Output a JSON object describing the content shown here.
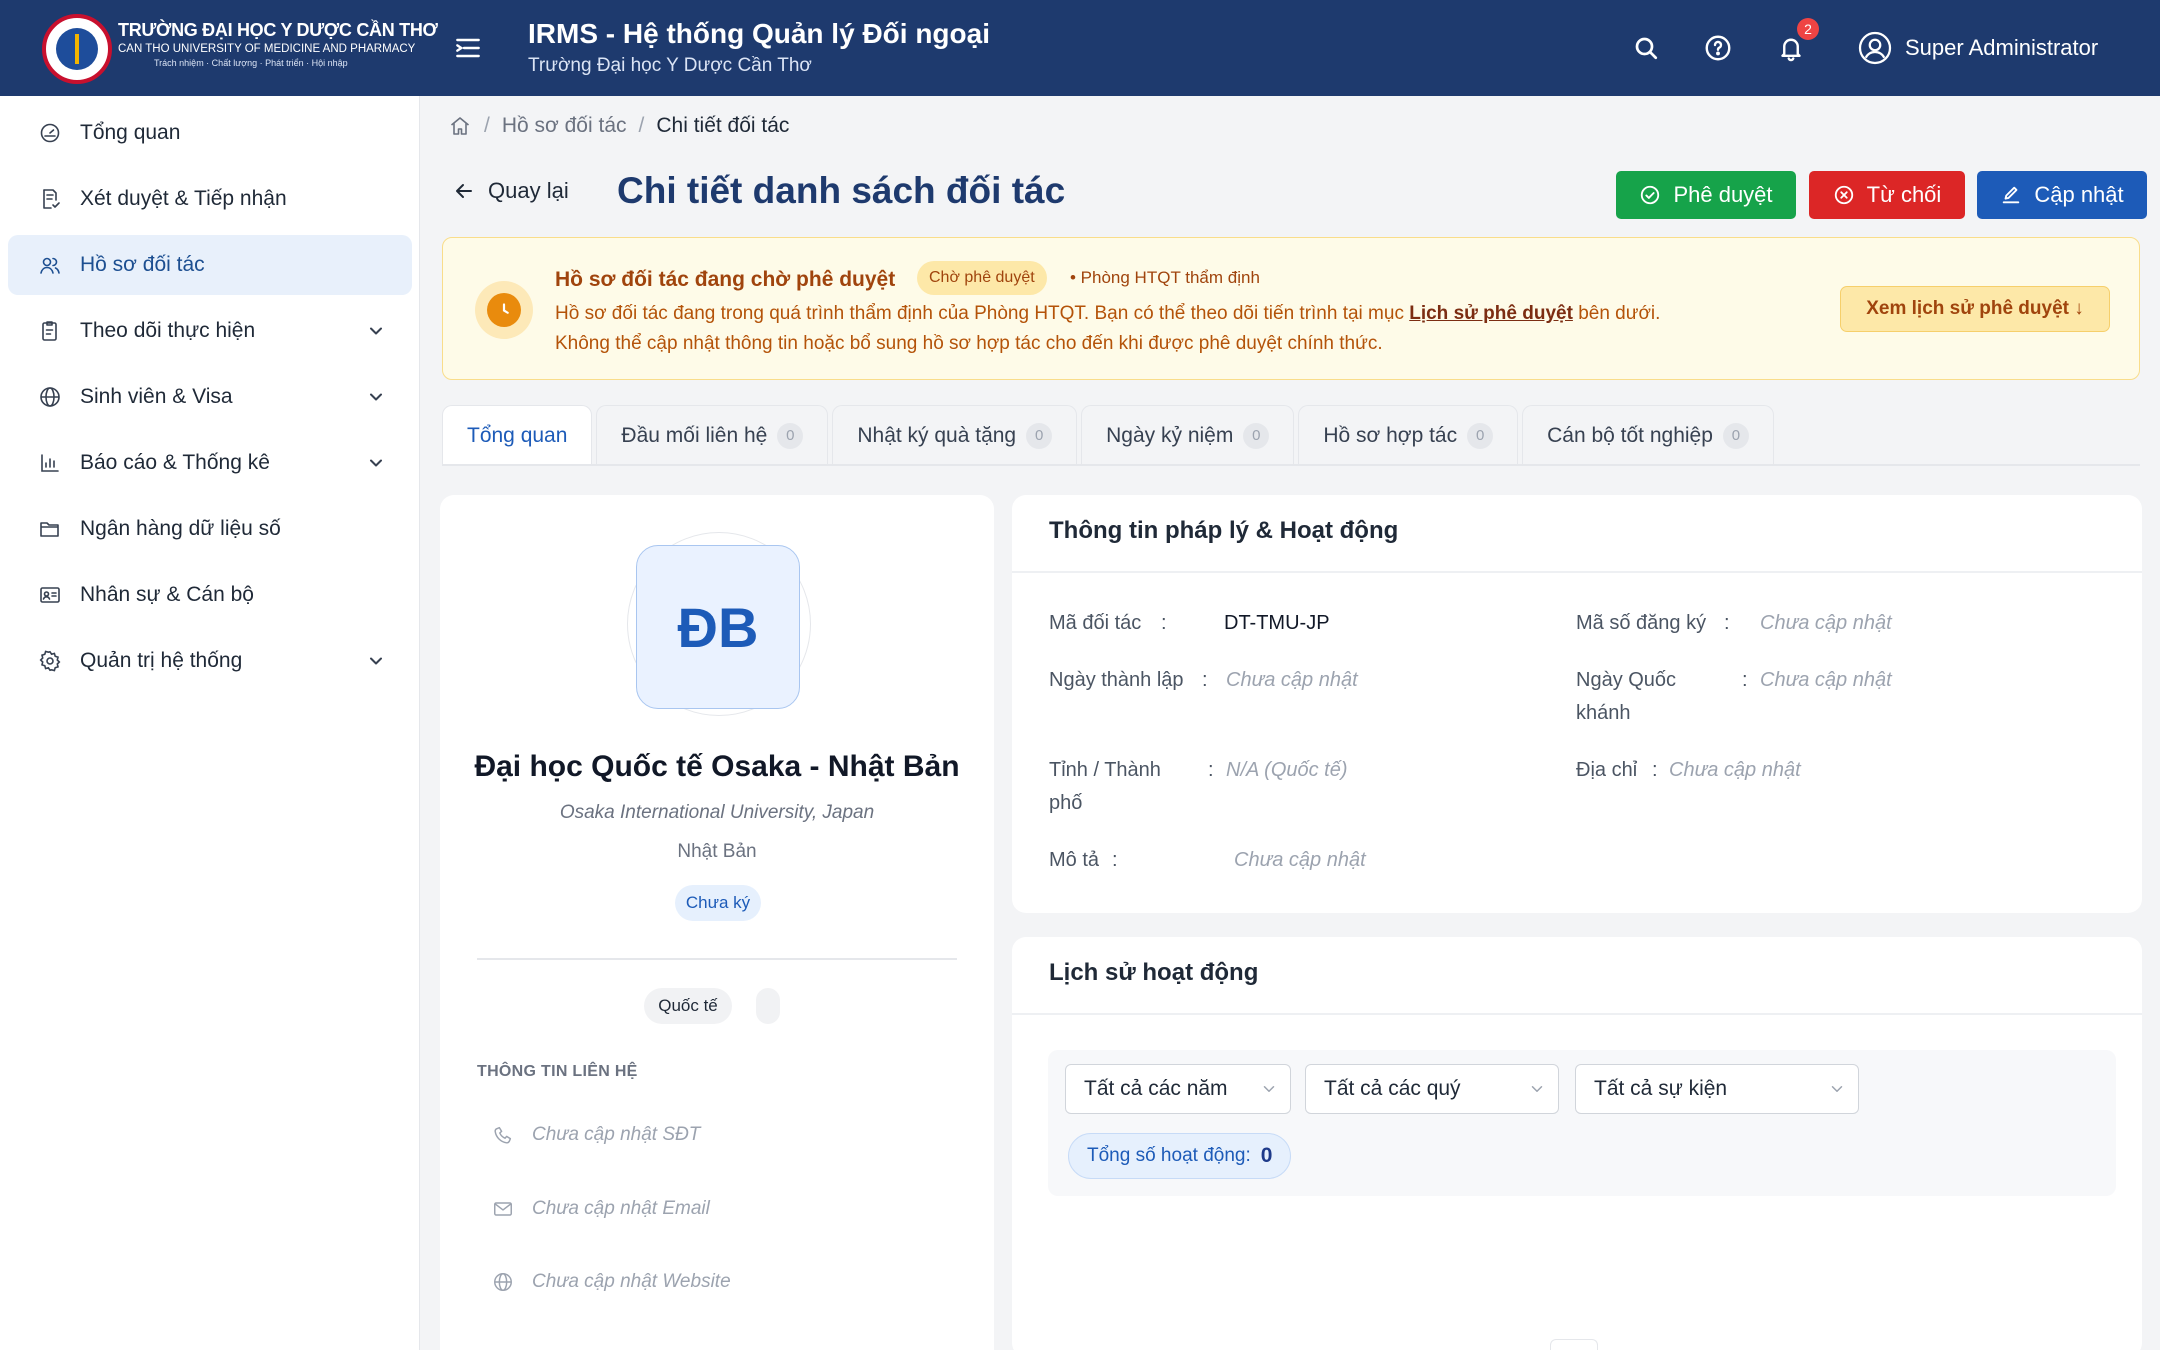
{
  "header": {
    "org_name": "TRƯỜNG ĐẠI HỌC Y DƯỢC CẦN THƠ",
    "org_name_en": "CAN THO UNIVERSITY OF MEDICINE AND PHARMACY",
    "org_motto": "Trách nhiệm · Chất lượng · Phát triển · Hội nhập",
    "app_title": "IRMS - Hệ thống Quản lý Đối ngoại",
    "app_subtitle": "Trường Đại học Y Dược Cần Thơ",
    "notification_count": "2",
    "user_name": "Super Administrator"
  },
  "sidebar": {
    "items": [
      {
        "label": "Tổng quan",
        "icon": "dashboard-icon"
      },
      {
        "label": "Xét duyệt & Tiếp nhận",
        "icon": "document-check-icon"
      },
      {
        "label": "Hồ sơ đối tác",
        "icon": "users-icon",
        "active": true
      },
      {
        "label": "Theo dõi thực hiện",
        "icon": "clipboard-icon",
        "expandable": true
      },
      {
        "label": "Sinh viên & Visa",
        "icon": "globe-icon",
        "expandable": true
      },
      {
        "label": "Báo cáo & Thống kê",
        "icon": "bar-chart-icon",
        "expandable": true
      },
      {
        "label": "Ngân hàng dữ liệu số",
        "icon": "folder-icon"
      },
      {
        "label": "Nhân sự & Cán bộ",
        "icon": "id-card-icon"
      },
      {
        "label": "Quản trị hệ thống",
        "icon": "gear-icon",
        "expandable": true
      }
    ]
  },
  "breadcrumb": {
    "items": [
      "Hồ sơ đối tác",
      "Chi tiết đối tác"
    ]
  },
  "page": {
    "back_label": "Quay lại",
    "title": "Chi tiết danh sách đối tác",
    "approve_label": "Phê duyệt",
    "reject_label": "Từ chối",
    "update_label": "Cập nhật"
  },
  "alert": {
    "title": "Hồ sơ đối tác đang chờ phê duyệt",
    "badge": "Chờ phê duyệt",
    "note": "• Phòng HTQT thẩm định",
    "line1_before": "Hồ sơ đối tác đang trong quá trình thẩm định của Phòng HTQT. Bạn có thể theo dõi tiến trình tại mục",
    "line1_link": "Lịch sử phê duyệt",
    "line1_after": "bên dưới.",
    "line2": "Không thể cập nhật thông tin hoặc bổ sung hồ sơ hợp tác cho đến khi được phê duyệt chính thức.",
    "button": "Xem lịch sử phê duyệt ↓"
  },
  "tabs": [
    {
      "label": "Tổng quan",
      "count": null,
      "active": true
    },
    {
      "label": "Đầu mối liên hệ",
      "count": "0"
    },
    {
      "label": "Nhật ký quà tặng",
      "count": "0"
    },
    {
      "label": "Ngày kỷ niệm",
      "count": "0"
    },
    {
      "label": "Hồ sơ hợp tác",
      "count": "0"
    },
    {
      "label": "Cán bộ tốt nghiệp",
      "count": "0"
    }
  ],
  "partner": {
    "initials": "ĐB",
    "name": "Đại học Quốc tế Osaka - Nhật Bản",
    "name_en": "Osaka International University, Japan",
    "country": "Nhật Bản",
    "status": "Chưa ký",
    "type_chip": "Quốc tế",
    "contact_heading": "THÔNG TIN LIÊN HỆ",
    "phone": "Chưa cập nhật SĐT",
    "email": "Chưa cập nhật Email",
    "website": "Chưa cập nhật Website"
  },
  "legal": {
    "title": "Thông tin pháp lý & Hoạt động",
    "fields": {
      "code_label": "Mã đối tác",
      "code_value": "DT-TMU-JP",
      "reg_label": "Mã số đăng ký",
      "reg_value": "Chưa cập nhật",
      "founded_label": "Ngày thành lập",
      "founded_value": "Chưa cập nhật",
      "national_day_label_1": "Ngày Quốc",
      "national_day_label_2": "khánh",
      "national_day_value": "Chưa cập nhật",
      "province_label_1": "Tỉnh / Thành",
      "province_label_2": "phố",
      "province_value": "N/A (Quốc tế)",
      "address_label": "Địa chỉ",
      "address_value": "Chưa cập nhật",
      "desc_label": "Mô tả",
      "desc_value": "Chưa cập nhật"
    }
  },
  "history": {
    "title": "Lịch sử hoạt động",
    "year_filter": "Tất cả các năm",
    "quarter_filter": "Tất cả các quý",
    "event_filter": "Tất cả sự kiện",
    "total_label": "Tổng số hoạt động:",
    "total_value": "0"
  },
  "colors": {
    "header_bg": "#1e3a6e",
    "approve": "#16a34a",
    "reject": "#dc2626",
    "update": "#1d5bb8",
    "alert_bg": "#fefbe8",
    "active_nav": "#e8f0fb"
  }
}
